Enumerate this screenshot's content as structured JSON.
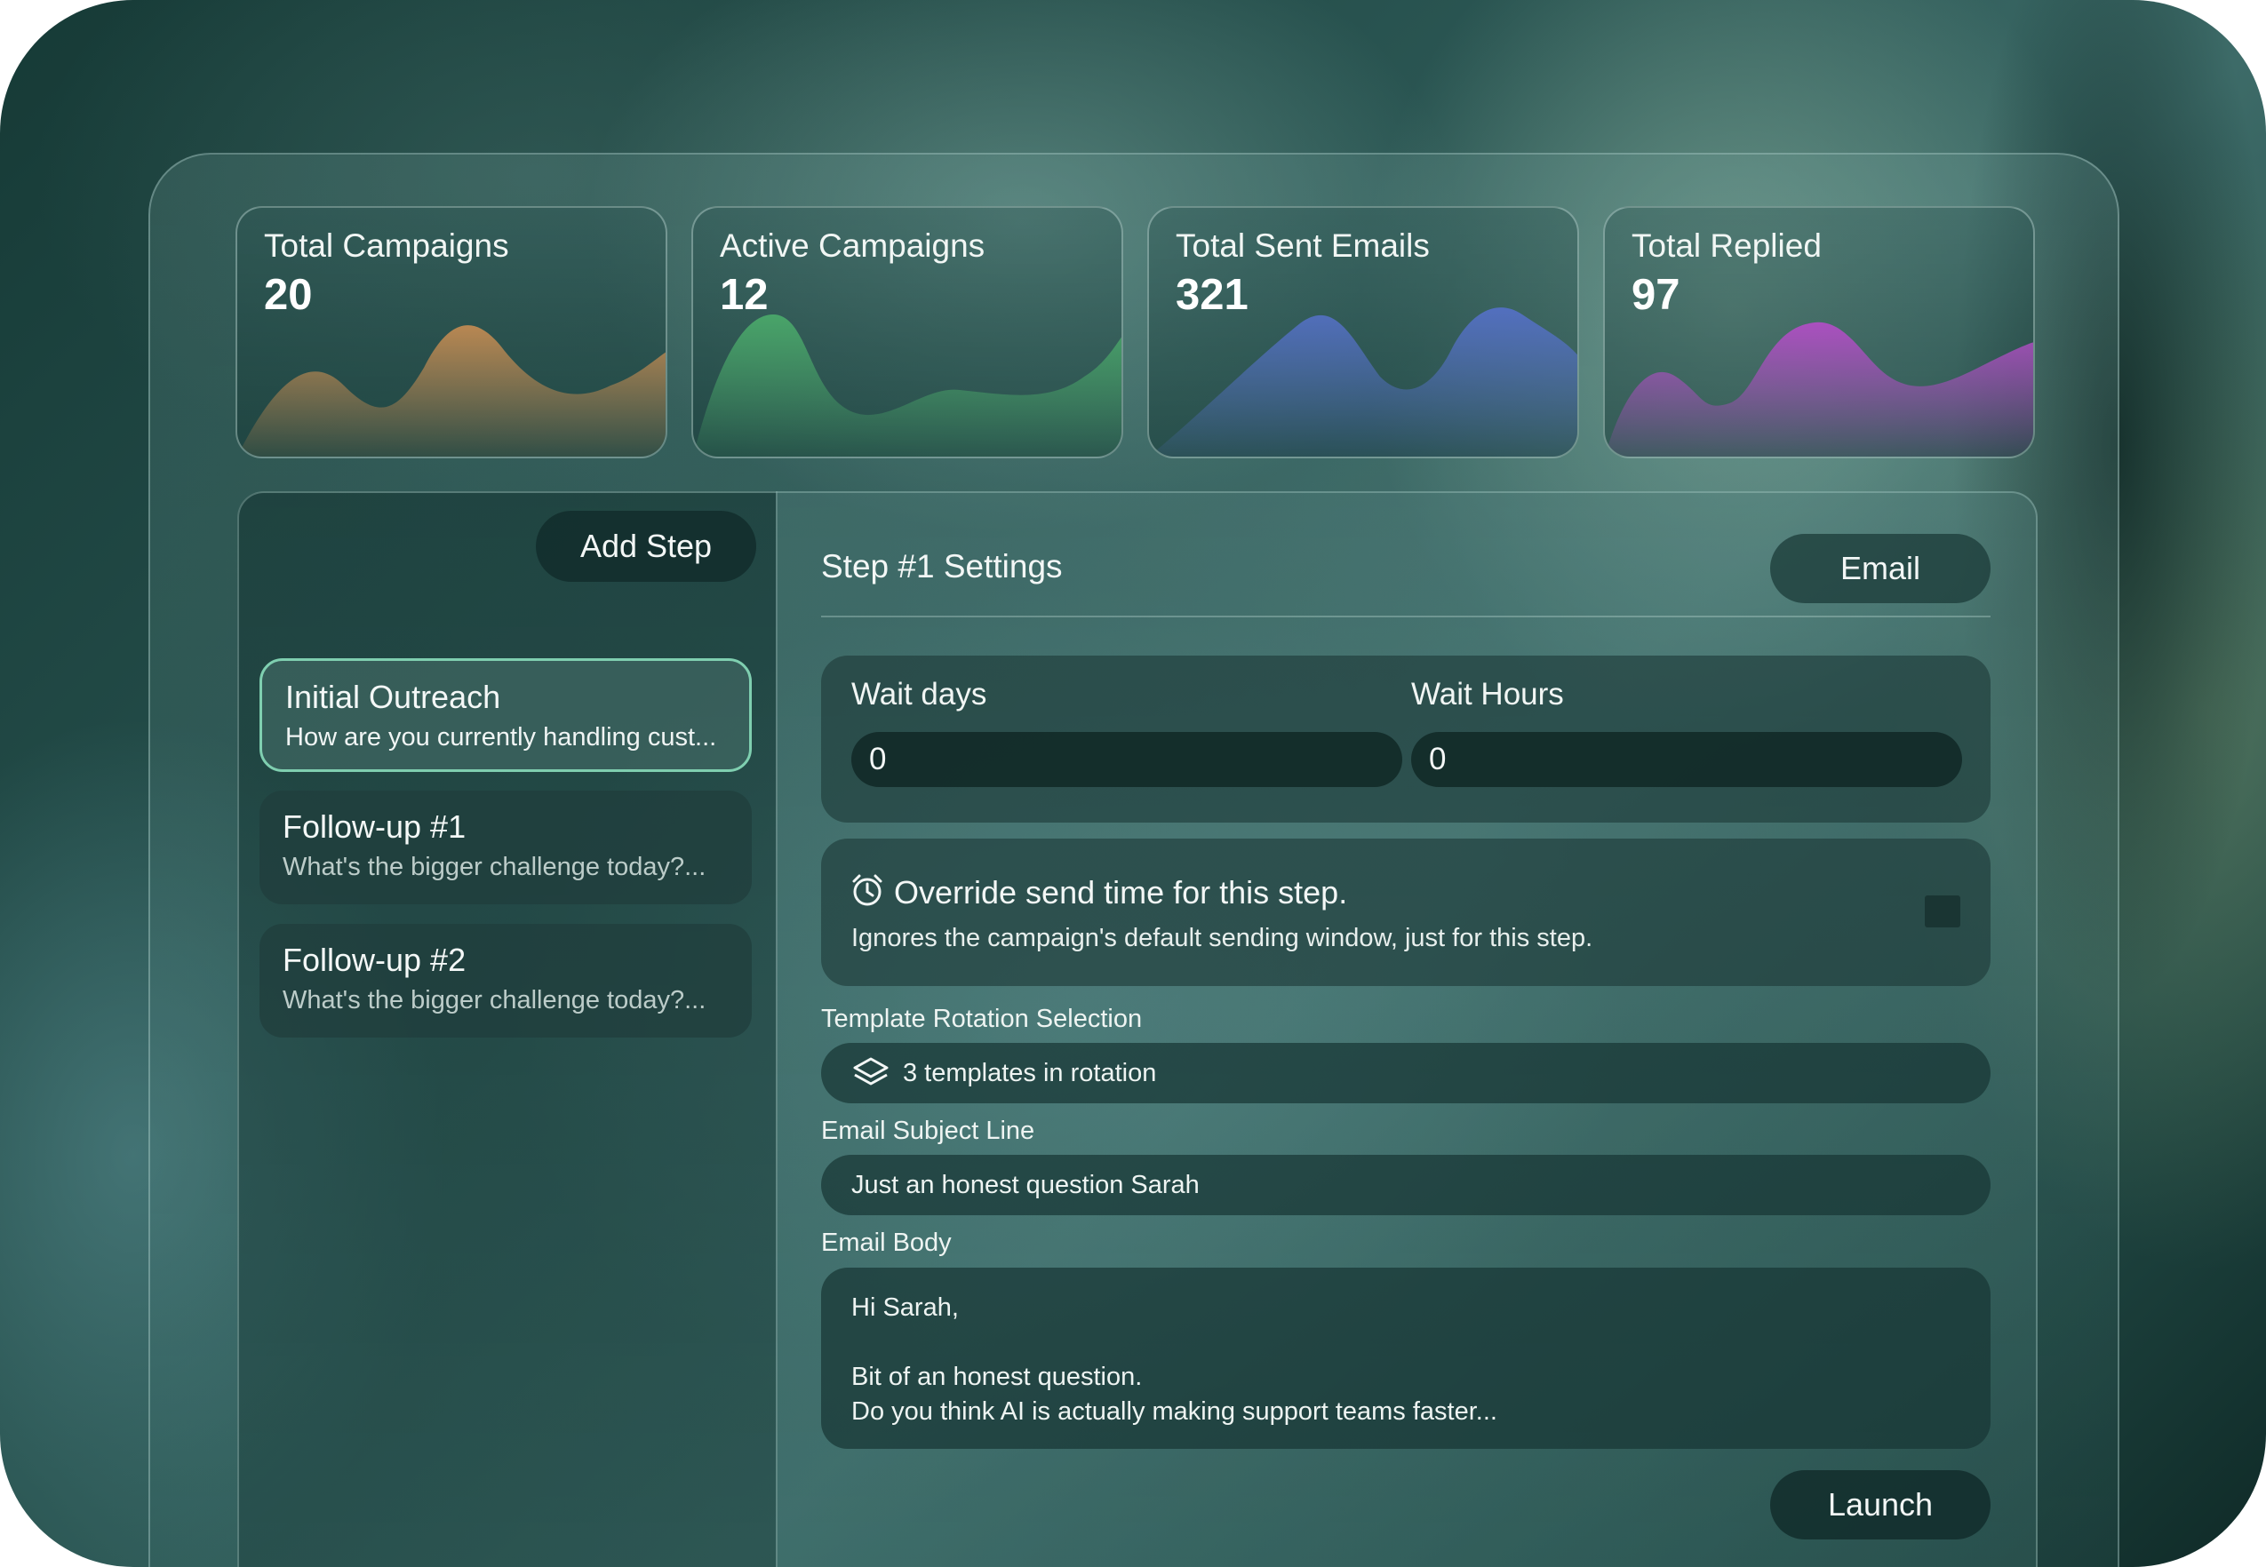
{
  "stats": [
    {
      "title": "Total Campaigns",
      "value": "20",
      "color": "#c08a52"
    },
    {
      "title": "Active Campaigns",
      "value": "12",
      "color": "#4aa86a"
    },
    {
      "title": "Total Sent Emails",
      "value": "321",
      "color": "#5470c4"
    },
    {
      "title": "Total Replied",
      "value": "97",
      "color": "#b04ec4"
    }
  ],
  "steps": {
    "add_label": "Add Step",
    "items": [
      {
        "name": "Initial Outreach",
        "preview": "How are you currently handling cust...",
        "active": true
      },
      {
        "name": "Follow-up #1",
        "preview": "What's the bigger challenge today?...",
        "active": false
      },
      {
        "name": "Follow-up #2",
        "preview": "What's the bigger challenge today?...",
        "active": false
      }
    ]
  },
  "settings": {
    "title": "Step #1 Settings",
    "type_label": "Email",
    "wait_days_label": "Wait days",
    "wait_days_value": "0",
    "wait_hours_label": "Wait Hours",
    "wait_hours_value": "0",
    "override_title": "Override send time for this step.",
    "override_desc": "Ignores the campaign's default sending window, just for this step.",
    "override_checked": false,
    "template_label": "Template Rotation Selection",
    "template_value": "3 templates in rotation",
    "subject_label": "Email Subject Line",
    "subject_value": "Just an honest question Sarah",
    "body_label": "Email Body",
    "body_lines": [
      "Hi Sarah,",
      "",
      "Bit of an honest question.",
      "Do you think AI is actually making support teams faster..."
    ],
    "launch_label": "Launch"
  }
}
